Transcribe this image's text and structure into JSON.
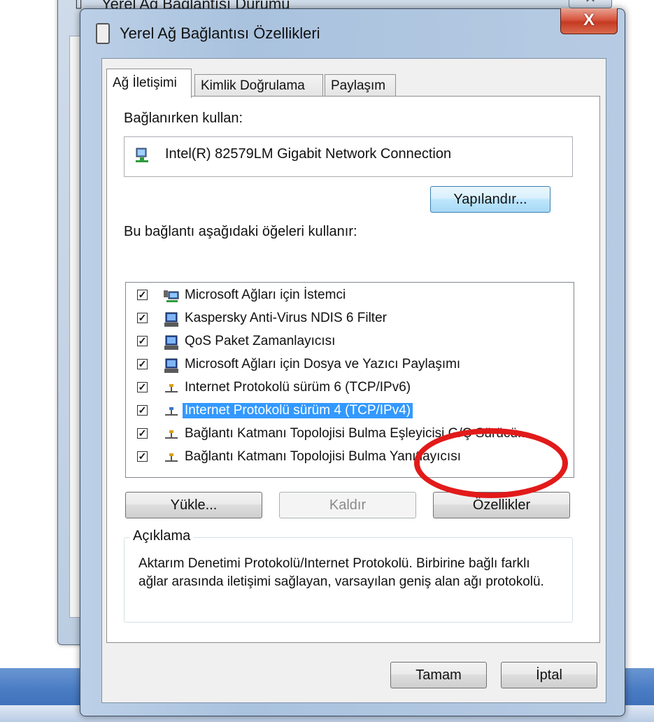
{
  "background_window": {
    "title": "Yerel Ağ Bağlantısı Durumu",
    "close_glyph": "✕"
  },
  "dialog": {
    "title": "Yerel Ağ Bağlantısı Özellikleri",
    "close_glyph": "X",
    "tabs": [
      {
        "label": "Ağ İletişimi",
        "active": true
      },
      {
        "label": "Kimlik Doğrulama",
        "active": false
      },
      {
        "label": "Paylaşım",
        "active": false
      }
    ],
    "connect_using_label": "Bağlanırken kullan:",
    "adapter_name": "Intel(R) 82579LM Gigabit Network Connection",
    "configure_button": "Yapılandır...",
    "items_label": "Bu bağlantı aşağıdaki öğeleri kullanır:",
    "items": [
      {
        "label": "Microsoft Ağları için İstemci",
        "checked": true,
        "icon": "network-client-icon",
        "selected": false
      },
      {
        "label": "Kaspersky Anti-Virus NDIS 6 Filter",
        "checked": true,
        "icon": "network-service-icon",
        "selected": false
      },
      {
        "label": "QoS Paket Zamanlayıcısı",
        "checked": true,
        "icon": "network-service-icon",
        "selected": false
      },
      {
        "label": "Microsoft Ağları için Dosya ve Yazıcı Paylaşımı",
        "checked": true,
        "icon": "network-service-icon",
        "selected": false
      },
      {
        "label": "Internet Protokolü sürüm 6 (TCP/IPv6)",
        "checked": true,
        "icon": "protocol-icon",
        "selected": false
      },
      {
        "label": "Internet Protokolü sürüm 4 (TCP/IPv4)",
        "checked": true,
        "icon": "protocol-icon",
        "selected": true
      },
      {
        "label": "Bağlantı Katmanı Topolojisi Bulma Eşleyicisi G/Ç Sürücü...",
        "checked": true,
        "icon": "protocol-icon",
        "selected": false
      },
      {
        "label": "Bağlantı Katmanı Topolojisi Bulma Yanıtlayıcısı",
        "checked": true,
        "icon": "protocol-icon",
        "selected": false
      }
    ],
    "install_button": "Yükle...",
    "uninstall_button": "Kaldır",
    "properties_button": "Özellikler",
    "description_title": "Açıklama",
    "description_text": "Aktarım Denetimi Protokolü/Internet Protokolü. Birbirine bağlı farklı ağlar arasında iletişimi sağlayan, varsayılan geniş alan ağı protokolü.",
    "ok_button": "Tamam",
    "cancel_button": "İptal"
  },
  "colors": {
    "selection": "#3399ff",
    "highlight_annotation": "#e21a1a",
    "close_button": "#c43a21"
  }
}
